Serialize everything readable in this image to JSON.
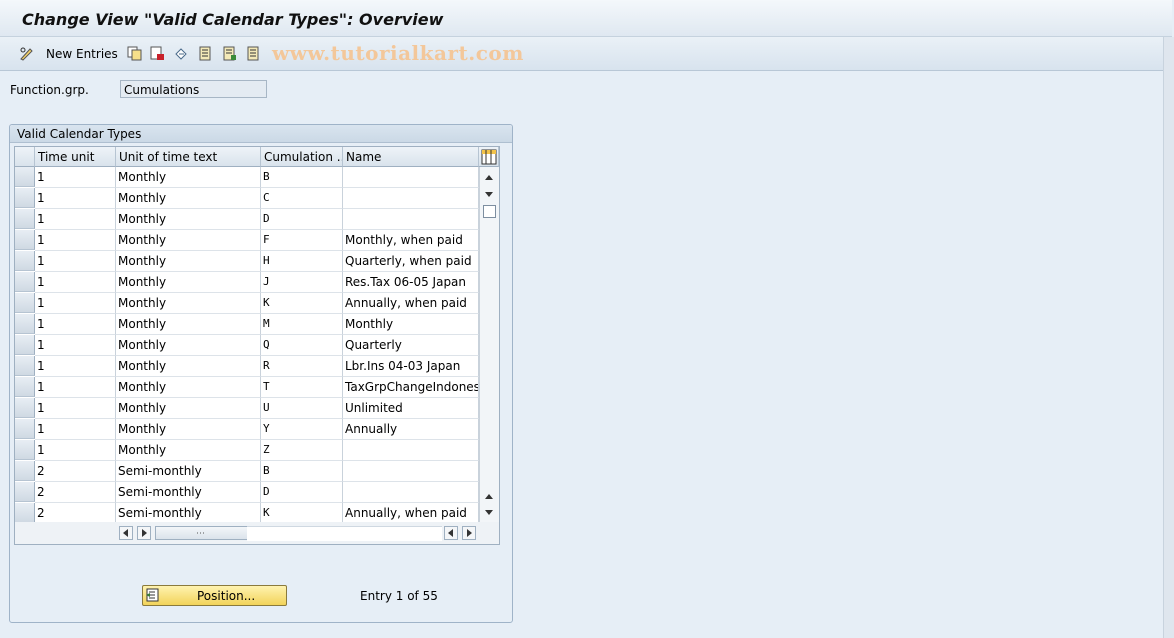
{
  "window": {
    "title": "Change View \"Valid Calendar Types\": Overview"
  },
  "toolbar": {
    "new_entries_label": "New Entries",
    "watermark": "www.tutorialkart.com"
  },
  "form": {
    "function_grp_label": "Function.grp.",
    "function_grp_value": "Cumulations"
  },
  "group": {
    "title": "Valid Calendar Types"
  },
  "table": {
    "columns": [
      "Time unit",
      "Unit of time text",
      "Cumulation ...",
      "Name"
    ],
    "rows": [
      [
        "1",
        "Monthly",
        "B",
        ""
      ],
      [
        "1",
        "Monthly",
        "C",
        ""
      ],
      [
        "1",
        "Monthly",
        "D",
        ""
      ],
      [
        "1",
        "Monthly",
        "F",
        "Monthly, when paid"
      ],
      [
        "1",
        "Monthly",
        "H",
        "Quarterly, when paid"
      ],
      [
        "1",
        "Monthly",
        "J",
        "Res.Tax 06-05  Japan"
      ],
      [
        "1",
        "Monthly",
        "K",
        "Annually, when paid"
      ],
      [
        "1",
        "Monthly",
        "M",
        "Monthly"
      ],
      [
        "1",
        "Monthly",
        "Q",
        "Quarterly"
      ],
      [
        "1",
        "Monthly",
        "R",
        "Lbr.Ins 04-03  Japan"
      ],
      [
        "1",
        "Monthly",
        "T",
        "TaxGrpChangeIndones."
      ],
      [
        "1",
        "Monthly",
        "U",
        "Unlimited"
      ],
      [
        "1",
        "Monthly",
        "Y",
        "Annually"
      ],
      [
        "1",
        "Monthly",
        "Z",
        ""
      ],
      [
        "2",
        "Semi-monthly",
        "B",
        ""
      ],
      [
        "2",
        "Semi-monthly",
        "D",
        ""
      ],
      [
        "2",
        "Semi-monthly",
        "K",
        "Annually, when paid"
      ]
    ]
  },
  "footer": {
    "position_label": "Position...",
    "entry_text": "Entry 1 of 55"
  }
}
